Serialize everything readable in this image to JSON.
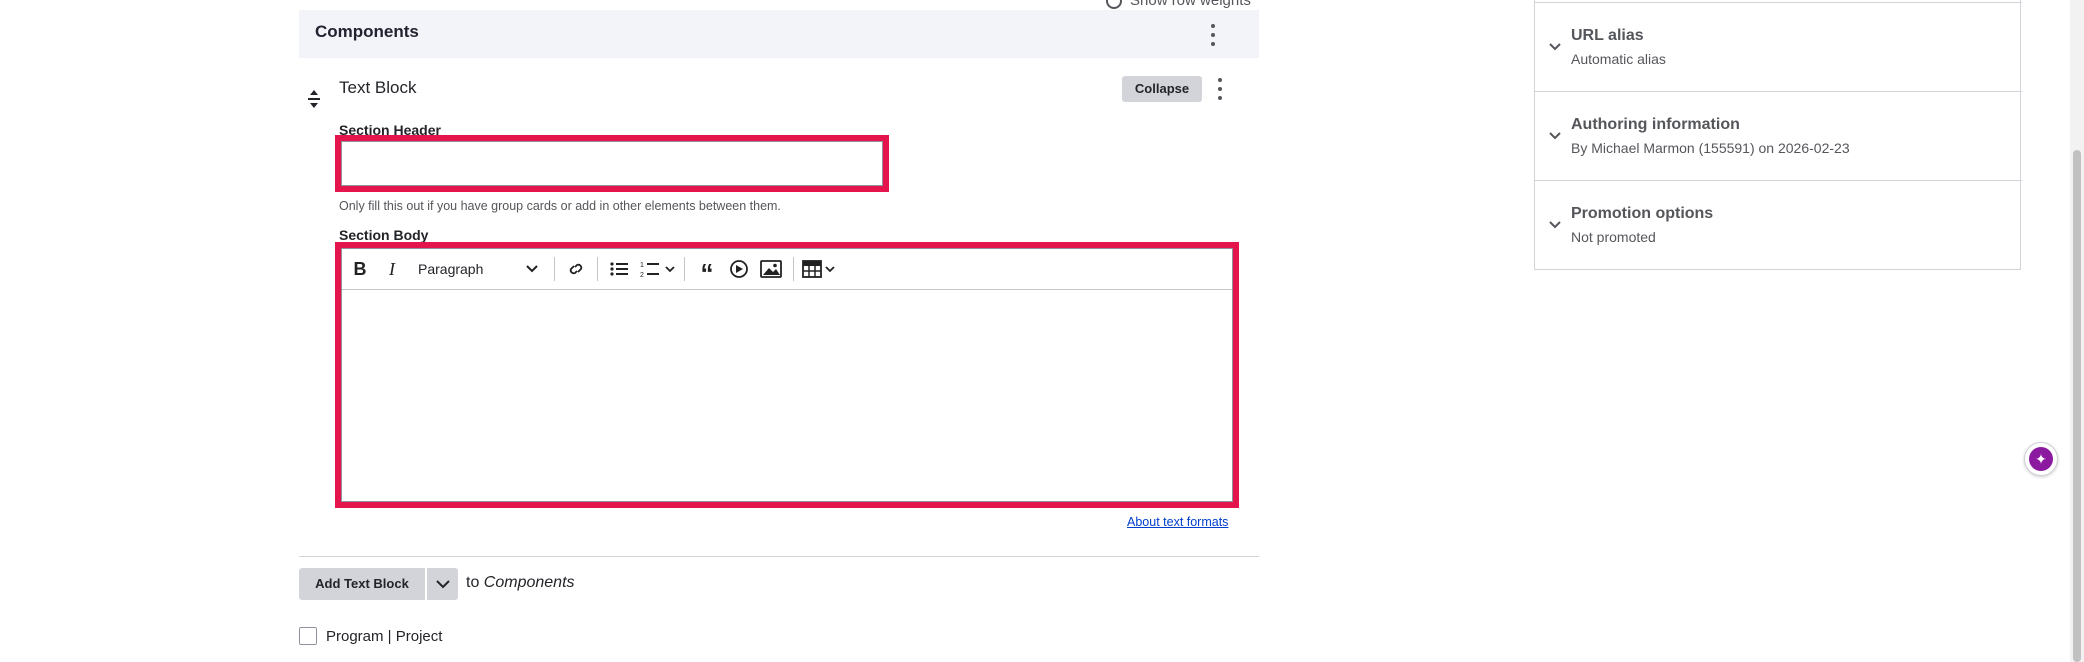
{
  "top": {
    "row_weights_label": "Show row weights"
  },
  "components": {
    "title": "Components",
    "block": {
      "title": "Text Block",
      "collapse_label": "Collapse",
      "section_header": {
        "label": "Section Header",
        "value": "",
        "description": "Only fill this out if you have group cards or add in other elements between them."
      },
      "section_body": {
        "label": "Section Body",
        "format_select": "Paragraph",
        "value": "",
        "about_link": "About text formats"
      }
    },
    "add_button": "Add Text Block",
    "add_to_prefix": "to",
    "add_to_target": "Components"
  },
  "program_project": {
    "label": "Program | Project",
    "checked": false
  },
  "sidebar": {
    "items": [
      {
        "title": "URL alias",
        "subtitle": "Automatic alias"
      },
      {
        "title": "Authoring information",
        "subtitle": "By Michael Marmon (155591) on 2026-02-23"
      },
      {
        "title": "Promotion options",
        "subtitle": "Not promoted"
      }
    ]
  },
  "colors": {
    "highlight": "#e4144c",
    "ai_button": "#8c1aa0",
    "link": "#003ecc"
  },
  "icons": [
    "bold-icon",
    "italic-icon",
    "link-icon",
    "bulleted-list-icon",
    "numbered-list-icon",
    "blockquote-icon",
    "media-icon",
    "image-icon",
    "table-icon",
    "chevron-down-icon",
    "kebab-icon",
    "drag-handle-icon",
    "sparkle-icon"
  ]
}
